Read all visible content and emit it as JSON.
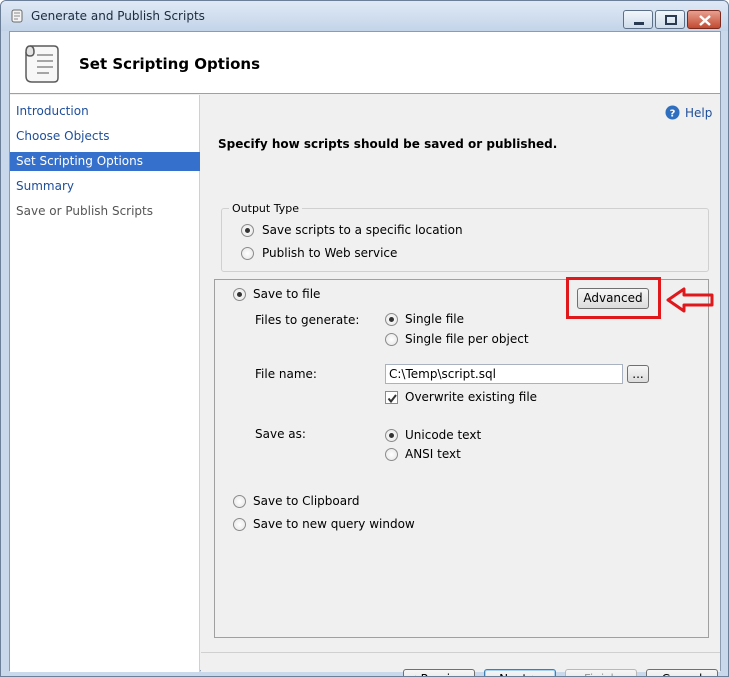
{
  "window": {
    "title": "Generate and Publish Scripts",
    "header_title": "Set Scripting Options",
    "icon": "scroll-icon"
  },
  "nav": {
    "items": [
      {
        "label": "Introduction",
        "state": "link"
      },
      {
        "label": "Choose Objects",
        "state": "link"
      },
      {
        "label": "Set Scripting Options",
        "state": "active"
      },
      {
        "label": "Summary",
        "state": "link"
      },
      {
        "label": "Save or Publish Scripts",
        "state": "disabled"
      }
    ]
  },
  "help": {
    "label": "Help"
  },
  "instruction": "Specify how scripts should be saved or published.",
  "output_type": {
    "title": "Output Type",
    "options": [
      {
        "label": "Save scripts to a specific location",
        "checked": true
      },
      {
        "label": "Publish to Web service",
        "checked": false
      }
    ]
  },
  "save_options": {
    "save_to_file": "Save to file",
    "advanced_button": "Advanced",
    "files_to_generate_label": "Files to generate:",
    "files_options": [
      {
        "label": "Single file",
        "checked": true
      },
      {
        "label": "Single file per object",
        "checked": false
      }
    ],
    "file_name_label": "File name:",
    "file_name_value": "C:\\Temp\\script.sql",
    "browse_button": "...",
    "overwrite_label": "Overwrite existing file",
    "overwrite_checked": true,
    "save_as_label": "Save as:",
    "save_as_options": [
      {
        "label": "Unicode text",
        "checked": true
      },
      {
        "label": "ANSI text",
        "checked": false
      }
    ],
    "save_to_clipboard": "Save to Clipboard",
    "save_to_query_window": "Save to new query window"
  },
  "buttons": {
    "previous": "< Previous",
    "next": "Next >",
    "finish": "Finish",
    "cancel": "Cancel"
  },
  "colors": {
    "annotation": "#e0171b",
    "nav_active_bg": "#3470cc",
    "link": "#1f4e9a"
  }
}
